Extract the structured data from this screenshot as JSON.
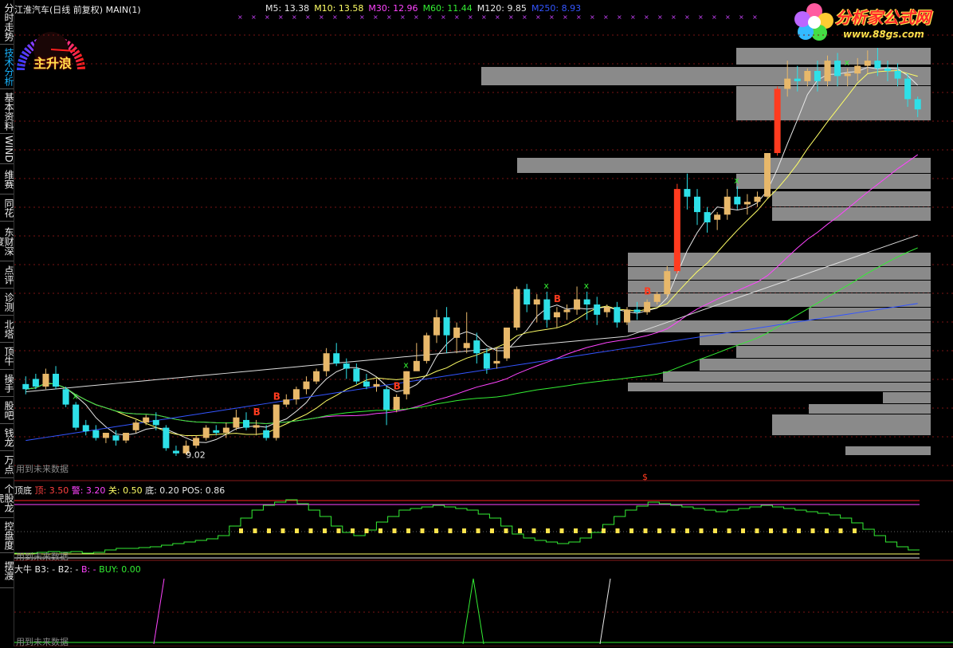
{
  "window": {
    "title": "江淮汽车(日线 前复权) MAIN(1)"
  },
  "sidebar": {
    "tabs": [
      {
        "label": "分时走势",
        "active": false
      },
      {
        "label": "技术分析",
        "active": true
      },
      {
        "label": "基本资料",
        "active": false
      },
      {
        "label": "WIND",
        "active": false
      },
      {
        "label": "维赛",
        "active": false
      },
      {
        "label": "同花",
        "active": false
      },
      {
        "label": "东财深度",
        "active": false
      },
      {
        "label": "点评",
        "active": false
      },
      {
        "label": "诊测",
        "active": false
      },
      {
        "label": "北塔",
        "active": false
      },
      {
        "label": "顶牛",
        "active": false
      },
      {
        "label": "操手",
        "active": false
      },
      {
        "label": "股吧",
        "active": false
      },
      {
        "label": "钱龙",
        "active": false
      },
      {
        "label": "万点",
        "active": false
      },
      {
        "label": "个股龙虎",
        "active": false
      },
      {
        "label": "控盘度",
        "active": false
      },
      {
        "label": "摆渡",
        "active": false
      }
    ]
  },
  "gauge": {
    "label": "主升浪",
    "icon": "speedometer-icon"
  },
  "logo": {
    "name": "分析家公式网",
    "url": "www.88gs.com",
    "icon": "flower-icon"
  },
  "ma_legend": [
    {
      "label": "M5: 13.38",
      "color": "#e8e8e8"
    },
    {
      "label": "M10: 13.58",
      "color": "#ffff66"
    },
    {
      "label": "M30: 12.96",
      "color": "#ff44ff"
    },
    {
      "label": "M60: 11.44",
      "color": "#33ee33"
    },
    {
      "label": "M120: 9.85",
      "color": "#e8e8e8"
    },
    {
      "label": "M250: 8.93",
      "color": "#3355ff"
    }
  ],
  "main_panel": {
    "future_note": "用到未来数据",
    "low_label": "9.02",
    "signal_B": "B",
    "signal_S": "S",
    "signal_dollar": "$"
  },
  "sub1": {
    "title": "顶底",
    "items": [
      {
        "label": "顶: 3.50",
        "color": "#ff4040"
      },
      {
        "label": "警: 3.20",
        "color": "#ff44ff"
      },
      {
        "label": "关: 0.50",
        "color": "#ffff66"
      },
      {
        "label": "底: 0.20",
        "color": "#e8e8e8"
      },
      {
        "label": "POS: 0.86",
        "color": "#e8e8e8"
      }
    ],
    "future_note": "用到未来数据"
  },
  "sub2": {
    "title": "大牛",
    "items": [
      {
        "label": "B3: -",
        "color": "#e8e8e8"
      },
      {
        "label": "B2: -",
        "color": "#e8e8e8"
      },
      {
        "label": "B: -",
        "color": "#ff44ff"
      },
      {
        "label": "BUY: 0.00",
        "color": "#33ee33"
      }
    ],
    "future_note": "用到未来数据"
  },
  "colors": {
    "up": "#e8b86a",
    "down": "#2ee0e8",
    "limit": "#ff3b1f",
    "grid": "#7a1414",
    "ma5": "#e8e8e8",
    "ma10": "#ffff66",
    "ma30": "#ff44ff",
    "ma60": "#33ee33",
    "ma120": "#dddddd",
    "ma250": "#3355ff",
    "volume_profile": "#8a8a8a"
  },
  "chart_data": {
    "type": "candlestick",
    "series_name": "江淮汽车",
    "period": "日线 前复权",
    "y_min_label": "9.02",
    "ma_last": {
      "M5": 13.38,
      "M10": 13.58,
      "M30": 12.96,
      "M60": 11.44,
      "M120": 9.85,
      "M250": 8.93
    },
    "candles": [
      [
        10.4,
        10.55,
        10.3,
        10.2
      ],
      [
        10.5,
        10.6,
        10.35,
        10.3
      ],
      [
        10.35,
        10.7,
        10.6,
        10.3
      ],
      [
        10.6,
        10.75,
        10.35,
        10.3
      ],
      [
        10.3,
        10.35,
        10.0,
        9.95
      ],
      [
        10.0,
        10.05,
        9.55,
        9.5
      ],
      [
        9.6,
        9.7,
        9.48,
        9.4
      ],
      [
        9.5,
        9.6,
        9.35,
        9.3
      ],
      [
        9.35,
        9.45,
        9.45,
        9.25
      ],
      [
        9.4,
        9.5,
        9.3,
        9.2
      ],
      [
        9.3,
        9.4,
        9.45,
        9.25
      ],
      [
        9.5,
        9.7,
        9.65,
        9.45
      ],
      [
        9.65,
        9.8,
        9.75,
        9.6
      ],
      [
        9.7,
        9.85,
        9.6,
        9.5
      ],
      [
        9.55,
        9.6,
        9.15,
        9.1
      ],
      [
        9.1,
        9.2,
        9.05,
        9.0
      ],
      [
        9.05,
        9.3,
        9.2,
        9.02
      ],
      [
        9.2,
        9.4,
        9.35,
        9.15
      ],
      [
        9.35,
        9.6,
        9.55,
        9.3
      ],
      [
        9.5,
        9.6,
        9.45,
        9.4
      ],
      [
        9.45,
        9.65,
        9.55,
        9.35
      ],
      [
        9.55,
        9.9,
        9.75,
        9.5
      ],
      [
        9.7,
        9.85,
        9.55,
        9.5
      ],
      [
        9.55,
        9.7,
        9.6,
        9.4
      ],
      [
        9.5,
        9.6,
        9.35,
        9.3
      ],
      [
        9.35,
        10.0,
        10.0,
        9.3
      ],
      [
        10.0,
        10.2,
        10.1,
        9.95
      ],
      [
        10.1,
        10.35,
        10.3,
        10.0
      ],
      [
        10.3,
        10.55,
        10.45,
        10.2
      ],
      [
        10.45,
        10.7,
        10.65,
        10.4
      ],
      [
        10.65,
        11.1,
        11.0,
        10.55
      ],
      [
        11.0,
        11.2,
        10.8,
        10.75
      ],
      [
        10.8,
        10.9,
        10.7,
        10.5
      ],
      [
        10.7,
        10.8,
        10.45,
        10.4
      ],
      [
        10.45,
        10.6,
        10.35,
        10.3
      ],
      [
        10.35,
        10.5,
        10.4,
        10.25
      ],
      [
        10.3,
        10.35,
        9.9,
        9.6
      ],
      [
        9.9,
        10.2,
        10.15,
        9.85
      ],
      [
        10.2,
        10.65,
        10.65,
        10.1
      ],
      [
        10.65,
        11.2,
        10.85,
        10.75
      ],
      [
        10.85,
        11.4,
        11.35,
        10.8
      ],
      [
        11.35,
        11.85,
        11.7,
        11.2
      ],
      [
        11.7,
        11.9,
        11.35,
        11.0
      ],
      [
        11.3,
        11.6,
        11.5,
        11.0
      ],
      [
        11.1,
        11.8,
        11.2,
        11.0
      ],
      [
        11.25,
        11.4,
        11.0,
        10.8
      ],
      [
        11.0,
        11.1,
        10.7,
        10.6
      ],
      [
        10.8,
        11.1,
        10.85,
        10.7
      ],
      [
        10.9,
        11.5,
        11.5,
        10.85
      ],
      [
        11.5,
        12.3,
        12.25,
        11.45
      ],
      [
        12.25,
        12.35,
        11.95,
        11.8
      ],
      [
        11.95,
        12.15,
        12.05,
        11.6
      ],
      [
        12.05,
        12.2,
        11.65,
        11.5
      ],
      [
        11.7,
        11.9,
        11.8,
        11.5
      ],
      [
        11.8,
        11.95,
        11.85,
        11.65
      ],
      [
        11.85,
        12.3,
        12.05,
        11.75
      ],
      [
        12.05,
        12.2,
        11.95,
        11.65
      ],
      [
        11.95,
        12.1,
        11.75,
        11.55
      ],
      [
        11.8,
        11.95,
        11.9,
        11.7
      ],
      [
        11.9,
        12.0,
        11.6,
        11.5
      ],
      [
        11.6,
        11.9,
        11.85,
        11.55
      ],
      [
        11.85,
        12.0,
        11.8,
        11.65
      ],
      [
        11.8,
        12.05,
        12.0,
        11.75
      ],
      [
        12.0,
        12.2,
        12.15,
        11.95
      ],
      [
        12.15,
        12.7,
        12.6,
        12.1
      ],
      [
        12.6,
        14.3,
        14.2,
        12.55
      ],
      [
        14.2,
        14.5,
        14.05,
        13.8
      ],
      [
        14.05,
        14.2,
        13.75,
        13.5
      ],
      [
        13.75,
        13.85,
        13.55,
        13.35
      ],
      [
        13.6,
        13.75,
        13.7,
        13.4
      ],
      [
        13.7,
        14.2,
        14.05,
        13.6
      ],
      [
        14.05,
        14.25,
        13.9,
        13.8
      ],
      [
        13.9,
        14.1,
        13.95,
        13.7
      ],
      [
        13.95,
        14.15,
        14.05,
        13.85
      ],
      [
        14.05,
        14.9,
        14.9,
        14.0
      ],
      [
        14.9,
        16.2,
        16.15,
        14.85
      ],
      [
        16.15,
        16.7,
        16.35,
        16.0
      ],
      [
        16.35,
        16.6,
        16.3,
        16.1
      ],
      [
        16.3,
        16.55,
        16.5,
        16.2
      ],
      [
        16.5,
        16.7,
        16.3,
        16.1
      ],
      [
        16.3,
        16.8,
        16.7,
        16.2
      ],
      [
        16.7,
        16.85,
        16.4,
        16.2
      ],
      [
        16.4,
        16.55,
        16.45,
        16.2
      ],
      [
        16.45,
        16.75,
        16.6,
        16.3
      ],
      [
        16.6,
        16.9,
        16.7,
        16.45
      ],
      [
        16.7,
        16.95,
        16.55,
        16.4
      ],
      [
        16.55,
        16.7,
        16.5,
        16.3
      ],
      [
        16.5,
        16.65,
        16.35,
        16.2
      ],
      [
        16.35,
        16.45,
        15.95,
        15.8
      ],
      [
        15.95,
        16.0,
        15.75,
        15.6
      ]
    ]
  }
}
